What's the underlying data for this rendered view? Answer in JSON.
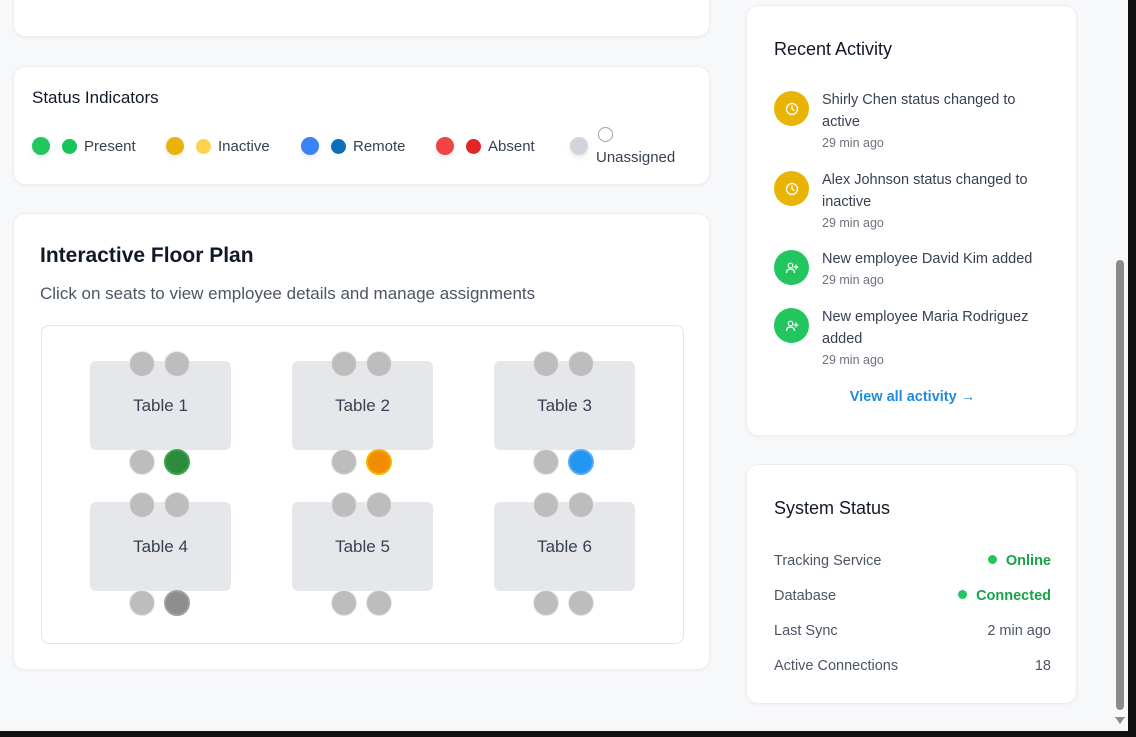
{
  "colors": {
    "present": "#22c55e",
    "inactive": "#eab308",
    "remote": "#3b82f6",
    "absent": "#ef4444",
    "unassigned": "#d1d5db",
    "link": "#1d8ed8",
    "online": "#16a34a"
  },
  "status_indicators": {
    "title": "Status Indicators",
    "items": [
      {
        "label": "Present",
        "primary": "#22c55e",
        "secondary": "#16c55a"
      },
      {
        "label": "Inactive",
        "primary": "#eab308",
        "secondary": "#fcd34d"
      },
      {
        "label": "Remote",
        "primary": "#3b82f6",
        "secondary": "#0b6fb8"
      },
      {
        "label": "Absent",
        "primary": "#ef4444",
        "secondary": "#e52424"
      },
      {
        "label": "Unassigned",
        "primary": "#d1d5db",
        "secondary": "#ffffff"
      }
    ]
  },
  "floor_plan": {
    "title": "Interactive Floor Plan",
    "subtitle": "Click on seats to view employee details and manage assignments",
    "tables": [
      {
        "label": "Table 1",
        "seats": [
          "empty",
          "empty",
          "empty",
          "present"
        ]
      },
      {
        "label": "Table 2",
        "seats": [
          "empty",
          "empty",
          "empty",
          "inactive"
        ]
      },
      {
        "label": "Table 3",
        "seats": [
          "empty",
          "empty",
          "empty",
          "remote"
        ]
      },
      {
        "label": "Table 4",
        "seats": [
          "empty",
          "empty",
          "empty",
          "occupied-gray"
        ]
      },
      {
        "label": "Table 5",
        "seats": [
          "empty",
          "empty",
          "empty",
          "empty"
        ]
      },
      {
        "label": "Table 6",
        "seats": [
          "empty",
          "empty",
          "empty",
          "empty"
        ]
      }
    ]
  },
  "recent_activity": {
    "title": "Recent Activity",
    "items": [
      {
        "text": "Shirly Chen status changed to active",
        "time": "29 min ago",
        "icon": "clock-icon",
        "color": "#eab308"
      },
      {
        "text": "Alex Johnson status changed to inactive",
        "time": "29 min ago",
        "icon": "clock-icon",
        "color": "#eab308"
      },
      {
        "text": "New employee David Kim added",
        "time": "29 min ago",
        "icon": "user-plus-icon",
        "color": "#22c55e"
      },
      {
        "text": "New employee Maria Rodriguez added",
        "time": "29 min ago",
        "icon": "user-plus-icon",
        "color": "#22c55e"
      }
    ],
    "view_all": "View all activity →"
  },
  "system_status": {
    "title": "System Status",
    "rows": [
      {
        "key": "Tracking Service",
        "value": "Online",
        "indicator": "green"
      },
      {
        "key": "Database",
        "value": "Connected",
        "indicator": "green"
      },
      {
        "key": "Last Sync",
        "value": "2 min ago"
      },
      {
        "key": "Active Connections",
        "value": "18"
      }
    ]
  }
}
